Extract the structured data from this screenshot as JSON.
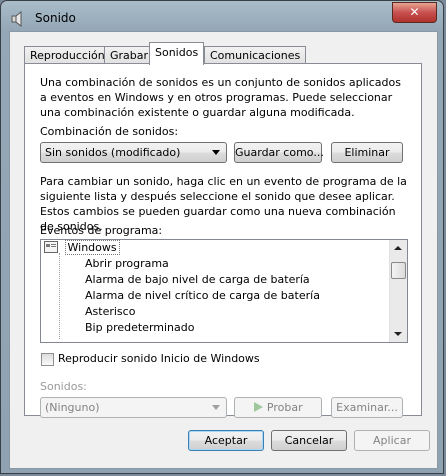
{
  "window": {
    "title": "Sonido",
    "close_label": "✕"
  },
  "tabs": [
    {
      "label": "Reproducción"
    },
    {
      "label": "Grabar"
    },
    {
      "label": "Sonidos"
    },
    {
      "label": "Comunicaciones"
    }
  ],
  "intro": "Una combinación de sonidos es un conjunto de sonidos aplicados a eventos en Windows y en otros programas. Puede seleccionar una combinación existente o guardar alguna modificada.",
  "scheme": {
    "label": "Combinación de sonidos:",
    "value": "Sin sonidos (modificado)",
    "save_label": "Guardar como...",
    "delete_label": "Eliminar"
  },
  "instructions": "Para cambiar un sonido, haga clic en un evento de programa de la siguiente lista y después seleccione el sonido que desee aplicar. Estos cambios se pueden guardar como una nueva combinación de sonidos.",
  "events": {
    "label": "Eventos de programa:",
    "root": "Windows",
    "items": [
      "Abrir programa",
      "Alarma de bajo nivel de carga de batería",
      "Alarma de nivel crítico de carga de batería",
      "Asterisco",
      "Bip predeterminado"
    ]
  },
  "startup": {
    "label": "Reproducir sonido Inicio de Windows",
    "checked": false
  },
  "sounds": {
    "label": "Sonidos:",
    "value": "(Ninguno)",
    "test_label": "Probar",
    "browse_label": "Examinar..."
  },
  "footer": {
    "ok_label": "Aceptar",
    "cancel_label": "Cancelar",
    "apply_label": "Aplicar"
  }
}
